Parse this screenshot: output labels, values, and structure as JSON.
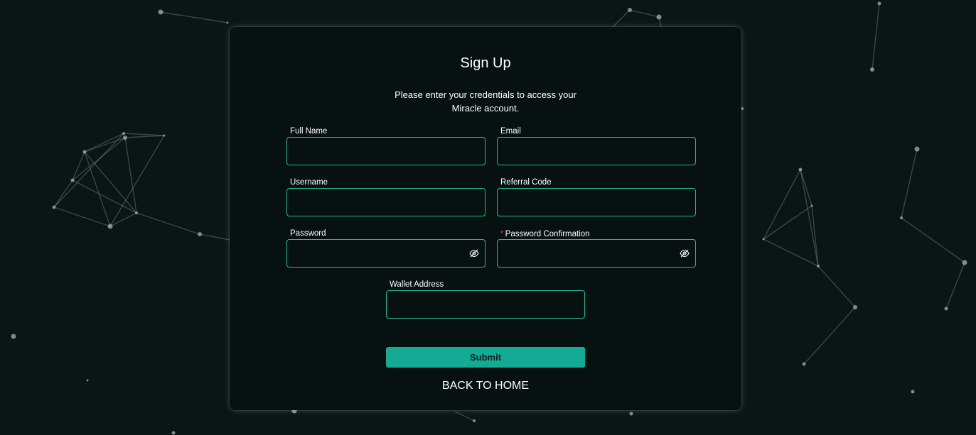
{
  "form": {
    "title": "Sign Up",
    "subtitle": "Please enter your credentials to access your Miracle account.",
    "fields": {
      "full_name": {
        "label": "Full Name",
        "value": ""
      },
      "email": {
        "label": "Email",
        "value": ""
      },
      "username": {
        "label": "Username",
        "value": ""
      },
      "referral_code": {
        "label": "Referral Code",
        "value": ""
      },
      "password": {
        "label": "Password",
        "value": "",
        "icon": "eye-slash-icon"
      },
      "password_confirmation": {
        "label": "Password Confirmation",
        "required_marker": "*",
        "value": "",
        "icon": "eye-slash-icon"
      },
      "wallet_address": {
        "label": "Wallet Address",
        "value": ""
      }
    },
    "submit_label": "Submit",
    "back_label": "BACK TO HOME"
  },
  "colors": {
    "background": "#0a1514",
    "card": "#071110",
    "accent": "#13ab93",
    "field_border": "#1fb89b",
    "required": "#e0342f"
  }
}
